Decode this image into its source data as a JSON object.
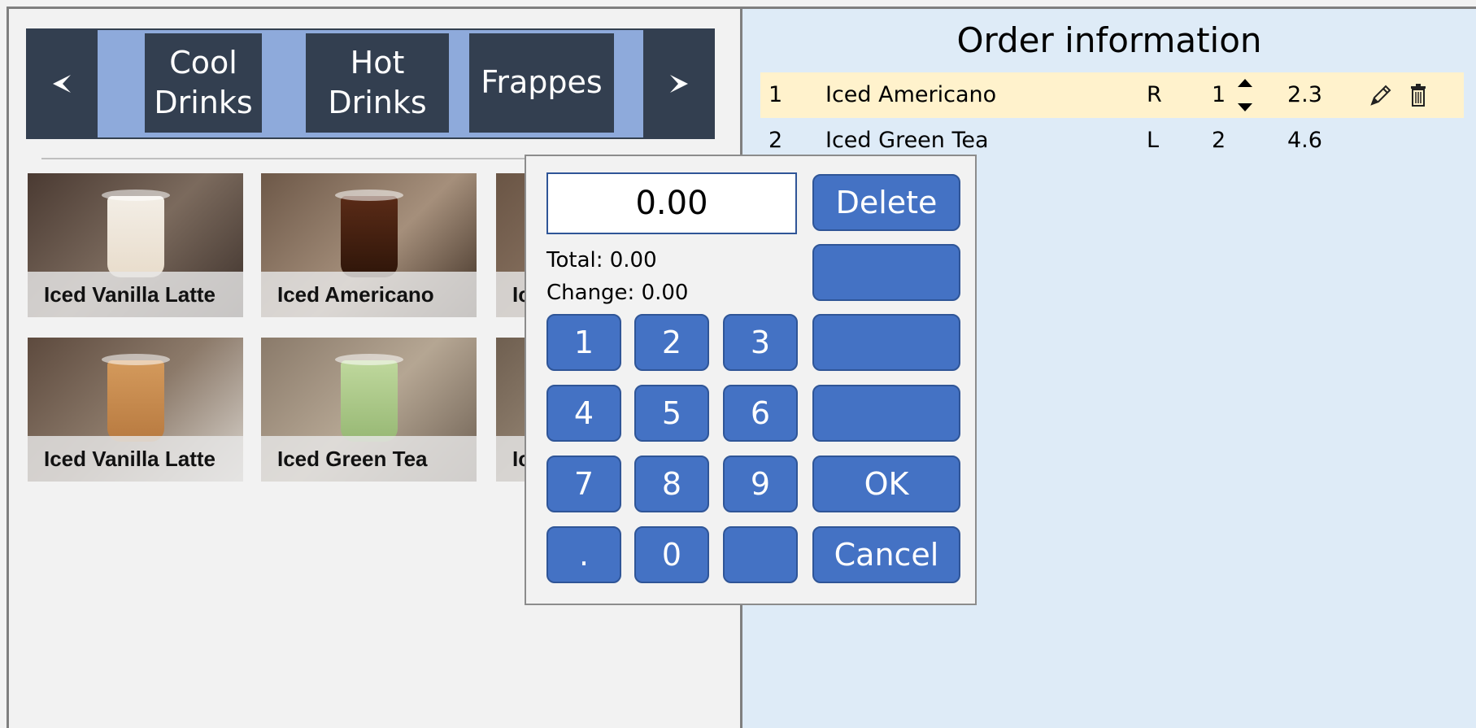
{
  "categories": {
    "prev_icon": "chevron-left-icon",
    "next_icon": "chevron-right-icon",
    "items": [
      {
        "label": "Cool\nDrinks"
      },
      {
        "label": "Hot\nDrinks"
      },
      {
        "label": "Frappes"
      }
    ]
  },
  "products": [
    {
      "name": "Iced Vanilla Latte"
    },
    {
      "name": "Iced Americano"
    },
    {
      "name": "Ic"
    },
    {
      "name": "Iced Vanilla Latte"
    },
    {
      "name": "Iced Green Tea"
    },
    {
      "name": "Ic"
    }
  ],
  "order": {
    "title": "Order information",
    "rows": [
      {
        "no": "1",
        "name": "Iced Americano",
        "size": "R",
        "qty": "1",
        "price": "2.3",
        "selected": true
      },
      {
        "no": "2",
        "name": "Iced Green Tea",
        "size": "L",
        "qty": "2",
        "price": "4.6",
        "selected": false
      }
    ]
  },
  "keypad": {
    "display_value": "0.00",
    "total_text": "Total: 0.00",
    "change_text": "Change: 0.00",
    "digits": [
      "1",
      "2",
      "3",
      "4",
      "5",
      "6",
      "7",
      "8",
      "9",
      ".",
      "0",
      ""
    ],
    "delete_label": "Delete",
    "ok_label": "OK",
    "cancel_label": "Cancel",
    "blank_labels": [
      "",
      "",
      ""
    ]
  },
  "colors": {
    "nav_dark": "#333f50",
    "category_track": "#8eaadb",
    "key_blue": "#4472c4",
    "order_bg": "#deebf7",
    "selected_row": "#fff2cc"
  }
}
